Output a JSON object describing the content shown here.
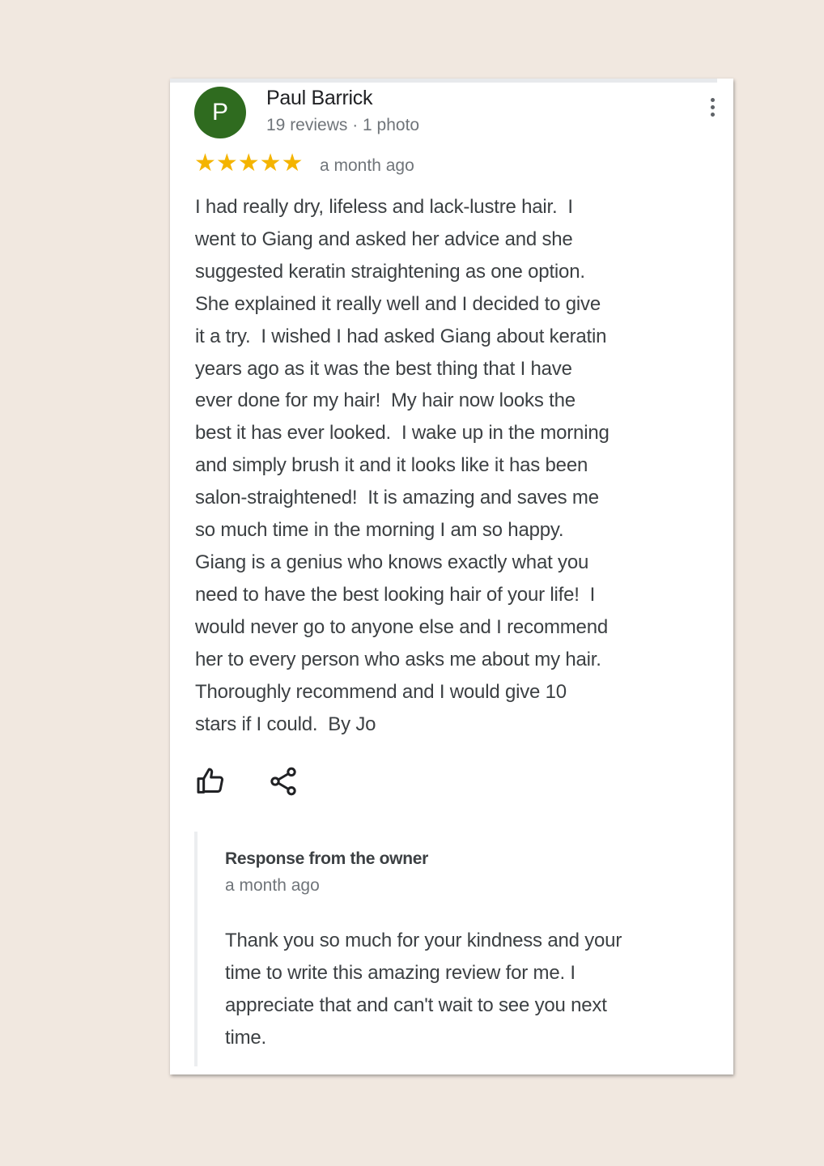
{
  "reviewer": {
    "initial": "P",
    "name": "Paul Barrick",
    "meta": "19 reviews · 1 photo",
    "avatar_color": "#2f6b1f"
  },
  "review": {
    "rating": 5,
    "max_rating": 5,
    "stars": "★★★★★",
    "date": "a month ago",
    "text": "I had really dry, lifeless and lack-lustre hair.  I\nwent to Giang and asked her advice and she\nsuggested keratin straightening as one option.\nShe explained it really well and I decided to give\nit a try.  I wished I had asked Giang about keratin\nyears ago as it was the best thing that I have\never done for my hair!  My hair now looks the\nbest it has ever looked.  I wake up in the morning\nand simply brush it and it looks like it has been\nsalon-straightened!  It is amazing and saves me\nso much time in the morning I am so happy.\nGiang is a genius who knows exactly what you\nneed to have the best looking hair of your life!  I\nwould never go to anyone else and I recommend\nher to every person who asks me about my hair.\nThoroughly recommend and I would give 10\nstars if I could.  By Jo"
  },
  "actions": {
    "like_icon": "thumbs-up-icon",
    "share_icon": "share-icon",
    "more_icon": "more-vertical-icon"
  },
  "owner_response": {
    "title": "Response from the owner",
    "date": "a month ago",
    "text": "Thank you so much for your kindness and your\ntime to write this amazing review for me. I\nappreciate that and can't wait to see you next\ntime."
  },
  "colors": {
    "star": "#f4b400",
    "background": "#f1e8e0"
  }
}
